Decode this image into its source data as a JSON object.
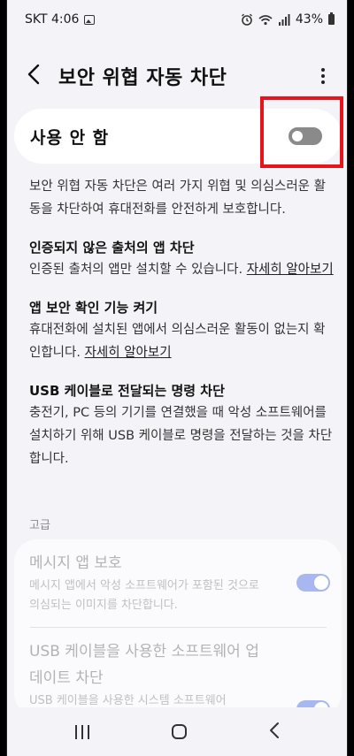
{
  "status_bar": {
    "carrier_time": "SKT 4:06",
    "battery": "43%"
  },
  "app_bar": {
    "title": "보안 위협 자동 차단",
    "back_glyph": "‹"
  },
  "master_switch": {
    "label": "사용 안 함",
    "state": "off"
  },
  "description": "보안 위협 자동 차단은 여러 가지 위협 및 의심스러운 활동을 차단하여 휴대전화를 안전하게 보호합니다.",
  "sections": [
    {
      "title": "인증되지 않은 출처의 앱 차단",
      "text": "인증된 출처의 앱만 설치할 수 있습니다. ",
      "link": "자세히 알아보기"
    },
    {
      "title": "앱 보안 확인 기능 켜기",
      "text": "휴대전화에 설치된 앱에서 의심스러운 활동이 없는지 확인합니다. ",
      "link": "자세히 알아보기"
    },
    {
      "title": "USB 케이블로 전달되는 명령 차단",
      "text": "충전기, PC 등의 기기를 연결했을 때 악성 소프트웨어를 설치하기 위해 USB 케이블로 명령을 전달하는 것을 차단합니다.",
      "link": ""
    }
  ],
  "advanced": {
    "label": "고급",
    "items": [
      {
        "title": "메시지 앱 보호",
        "subtitle": "메시지 앱에서 악성 소프트웨어가 포함된 것으로 의심되는 이미지를 차단합니다.",
        "state": "on"
      },
      {
        "title": "USB 케이블을 사용한 소프트웨어 업데이트 차단",
        "subtitle": "USB 케이블을 사용한 시스템 소프트웨어",
        "state": "on"
      }
    ]
  },
  "colors": {
    "highlight_box": "#e8141b",
    "toggle_on": "#a9b7f0",
    "toggle_off": "#8a8a8a"
  },
  "icons": {
    "back": "back-arrow-icon",
    "more": "more-vert-icon",
    "nav_recent": "recent-apps-icon",
    "nav_home": "home-icon",
    "nav_back": "nav-back-icon"
  }
}
